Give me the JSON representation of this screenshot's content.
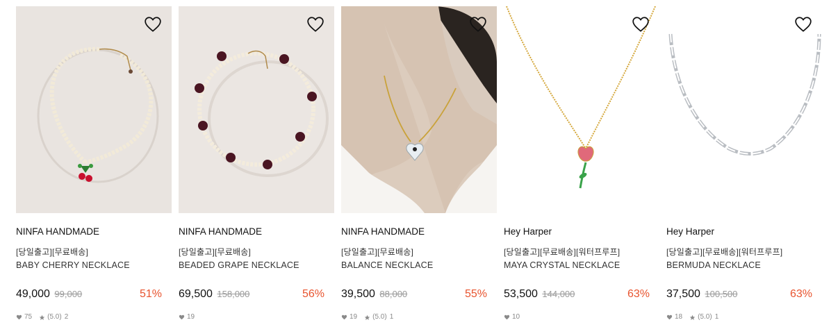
{
  "icons": {
    "wishlist": "heart-outline-icon",
    "likes": "heart-filled-icon",
    "rating": "star-icon"
  },
  "colors": {
    "discount": "#e8542f",
    "muted": "#8a8a8a"
  },
  "products": [
    {
      "brand": "NINFA HANDMADE",
      "tags": "[당일출고][무료배송]",
      "name": "BABY CHERRY NECKLACE",
      "price": "49,000",
      "original_price": "99,000",
      "discount": "51%",
      "likes": "75",
      "rating": "(5.0)",
      "reviews": "2"
    },
    {
      "brand": "NINFA HANDMADE",
      "tags": "[당일출고][무료배송]",
      "name": "BEADED GRAPE NECKLACE",
      "price": "69,500",
      "original_price": "158,000",
      "discount": "56%",
      "likes": "19",
      "rating": "",
      "reviews": ""
    },
    {
      "brand": "NINFA HANDMADE",
      "tags": "[당일출고][무료배송]",
      "name": "BALANCE NECKLACE",
      "price": "39,500",
      "original_price": "88,000",
      "discount": "55%",
      "likes": "19",
      "rating": "(5.0)",
      "reviews": "1"
    },
    {
      "brand": "Hey Harper",
      "tags": "[당일출고][무료배송][워터프루프]",
      "name": "MAYA CRYSTAL NECKLACE",
      "price": "53,500",
      "original_price": "144,000",
      "discount": "63%",
      "likes": "10",
      "rating": "",
      "reviews": ""
    },
    {
      "brand": "Hey Harper",
      "tags": "[당일출고][무료배송][워터프루프]",
      "name": "BERMUDA NECKLACE",
      "price": "37,500",
      "original_price": "100,500",
      "discount": "63%",
      "likes": "18",
      "rating": "(5.0)",
      "reviews": "1"
    }
  ]
}
